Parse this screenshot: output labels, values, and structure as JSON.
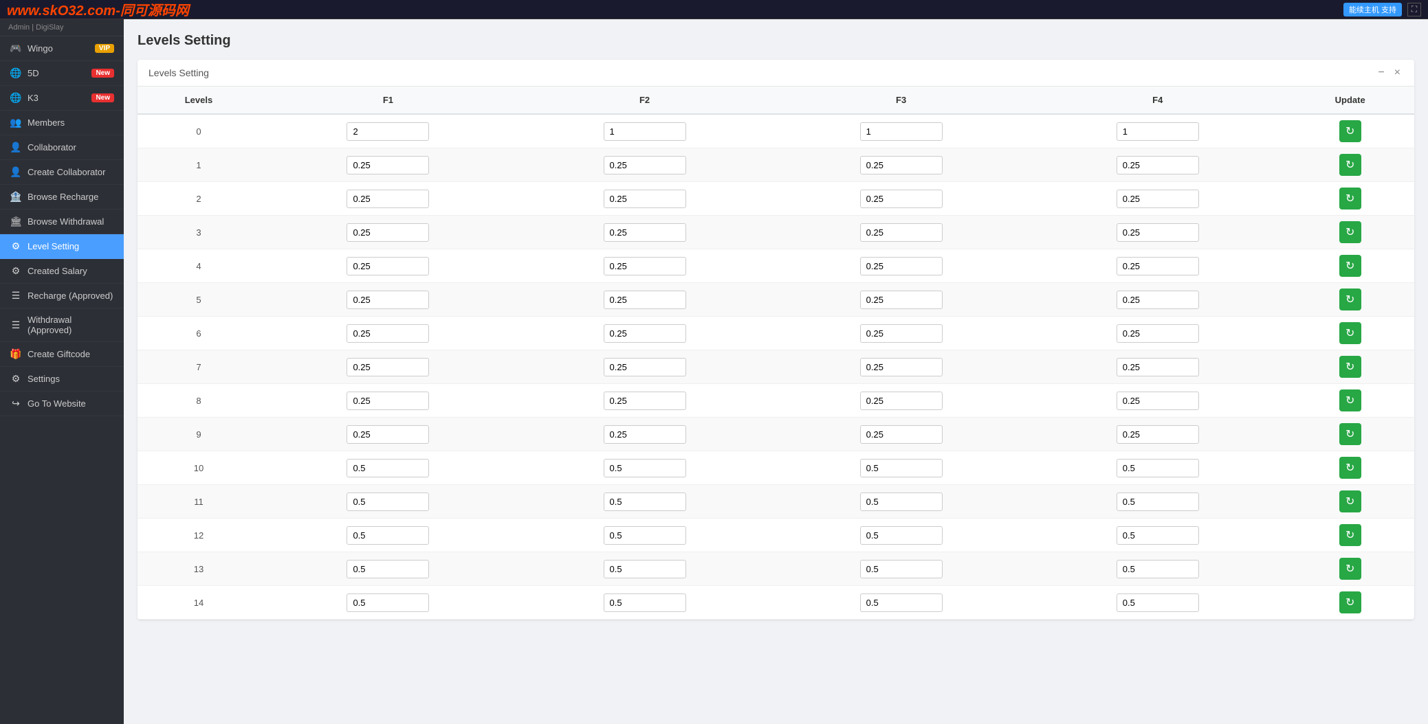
{
  "topbar": {
    "logo": "www.skO32.com-同可源码网",
    "admin_label": "Admin | DigiSlay",
    "btn_label": "能续主机 支持",
    "expand_icon": "⛶"
  },
  "sidebar": {
    "header": "Admin | DigiSlay",
    "items": [
      {
        "id": "wingo",
        "label": "Wingo",
        "icon": "🎮",
        "badge": "VIP",
        "badge_type": "vip",
        "active": false
      },
      {
        "id": "5d",
        "label": "5D",
        "icon": "🌐",
        "badge": "New",
        "badge_type": "new",
        "active": false
      },
      {
        "id": "k3",
        "label": "K3",
        "icon": "🌐",
        "badge": "New",
        "badge_type": "new",
        "active": false
      },
      {
        "id": "members",
        "label": "Members",
        "icon": "👥",
        "badge": null,
        "active": false
      },
      {
        "id": "collaborator",
        "label": "Collaborator",
        "icon": "👤",
        "badge": null,
        "active": false
      },
      {
        "id": "create-collaborator",
        "label": "Create Collaborator",
        "icon": "👤",
        "badge": null,
        "active": false
      },
      {
        "id": "browse-recharge",
        "label": "Browse Recharge",
        "icon": "🏦",
        "badge": null,
        "active": false
      },
      {
        "id": "browse-withdrawal",
        "label": "Browse Withdrawal",
        "icon": "🏛",
        "badge": null,
        "active": false
      },
      {
        "id": "level-setting",
        "label": "Level Setting",
        "icon": "⚙",
        "badge": null,
        "active": true
      },
      {
        "id": "created-salary",
        "label": "Created Salary",
        "icon": "⚙",
        "badge": null,
        "active": false
      },
      {
        "id": "recharge-approved",
        "label": "Recharge (Approved)",
        "icon": "☰",
        "badge": null,
        "active": false
      },
      {
        "id": "withdrawal-approved",
        "label": "Withdrawal (Approved)",
        "icon": "☰",
        "badge": null,
        "active": false
      },
      {
        "id": "create-giftcode",
        "label": "Create Giftcode",
        "icon": "🎁",
        "badge": null,
        "active": false
      },
      {
        "id": "settings",
        "label": "Settings",
        "icon": "⚙",
        "badge": null,
        "active": false
      },
      {
        "id": "go-to-website",
        "label": "Go To Website",
        "icon": "↪",
        "badge": null,
        "active": false
      }
    ]
  },
  "page": {
    "title": "Levels Setting",
    "card_title": "Levels Setting"
  },
  "table": {
    "columns": [
      "Levels",
      "F1",
      "F2",
      "F3",
      "F4",
      "Update"
    ],
    "rows": [
      {
        "level": "0",
        "f1": "2",
        "f2": "1",
        "f3": "1",
        "f4": "1"
      },
      {
        "level": "1",
        "f1": "0.25",
        "f2": "0.25",
        "f3": "0.25",
        "f4": "0.25"
      },
      {
        "level": "2",
        "f1": "0.25",
        "f2": "0.25",
        "f3": "0.25",
        "f4": "0.25"
      },
      {
        "level": "3",
        "f1": "0.25",
        "f2": "0.25",
        "f3": "0.25",
        "f4": "0.25"
      },
      {
        "level": "4",
        "f1": "0.25",
        "f2": "0.25",
        "f3": "0.25",
        "f4": "0.25"
      },
      {
        "level": "5",
        "f1": "0.25",
        "f2": "0.25",
        "f3": "0.25",
        "f4": "0.25"
      },
      {
        "level": "6",
        "f1": "0.25",
        "f2": "0.25",
        "f3": "0.25",
        "f4": "0.25"
      },
      {
        "level": "7",
        "f1": "0.25",
        "f2": "0.25",
        "f3": "0.25",
        "f4": "0.25"
      },
      {
        "level": "8",
        "f1": "0.25",
        "f2": "0.25",
        "f3": "0.25",
        "f4": "0.25"
      },
      {
        "level": "9",
        "f1": "0.25",
        "f2": "0.25",
        "f3": "0.25",
        "f4": "0.25"
      },
      {
        "level": "10",
        "f1": "0.5",
        "f2": "0.5",
        "f3": "0.5",
        "f4": "0.5"
      },
      {
        "level": "11",
        "f1": "0.5",
        "f2": "0.5",
        "f3": "0.5",
        "f4": "0.5"
      },
      {
        "level": "12",
        "f1": "0.5",
        "f2": "0.5",
        "f3": "0.5",
        "f4": "0.5"
      },
      {
        "level": "13",
        "f1": "0.5",
        "f2": "0.5",
        "f3": "0.5",
        "f4": "0.5"
      },
      {
        "level": "14",
        "f1": "0.5",
        "f2": "0.5",
        "f3": "0.5",
        "f4": "0.5"
      }
    ]
  }
}
